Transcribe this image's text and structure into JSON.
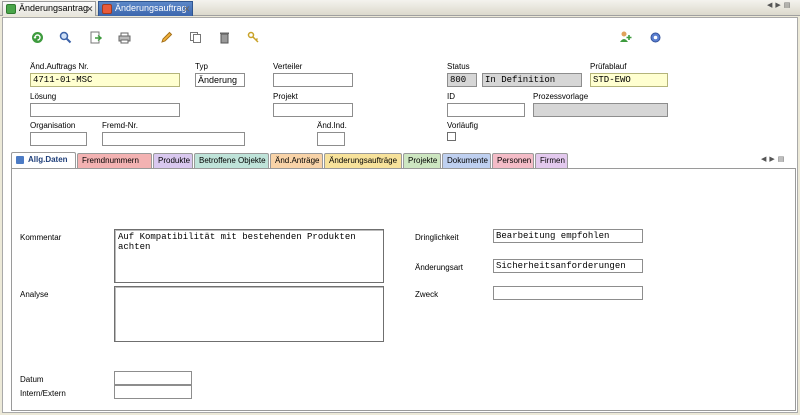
{
  "tabs": {
    "items": [
      {
        "label": "Änderungsantrag"
      },
      {
        "label": "Änderungsauftrag"
      }
    ]
  },
  "toolbar": {
    "icons": [
      "refresh-icon",
      "search-icon",
      "export-icon",
      "print-icon",
      "edit-icon",
      "copy-icon",
      "delete-icon",
      "key-icon",
      "user-add-icon",
      "settings-icon"
    ]
  },
  "form": {
    "auftrags_nr": {
      "label": "Änd.Auftrags Nr.",
      "value": "4711-01-MSC"
    },
    "typ": {
      "label": "Typ",
      "value": "Änderung"
    },
    "verteiler": {
      "label": "Verteiler",
      "value": ""
    },
    "status": {
      "label": "Status",
      "code": "800",
      "text": "In Definition"
    },
    "pruefablauf": {
      "label": "Prüfablauf",
      "value": "STD-EWO"
    },
    "loesung": {
      "label": "Lösung",
      "value": ""
    },
    "projekt": {
      "label": "Projekt",
      "value": ""
    },
    "id": {
      "label": "ID",
      "value": ""
    },
    "prozessvorlage": {
      "label": "Prozessvorlage",
      "value": ""
    },
    "organisation": {
      "label": "Organisation",
      "value": ""
    },
    "fremd_nr": {
      "label": "Fremd-Nr.",
      "value": ""
    },
    "aend_ind": {
      "label": "Änd.Ind.",
      "value": ""
    },
    "vorlaeufig": {
      "label": "Vorläufig",
      "checked": false
    }
  },
  "section_tabs": [
    {
      "label": "Allg.Daten",
      "color": "#ffffff"
    },
    {
      "label": "Fremdnummern",
      "color": "#f3b2b2"
    },
    {
      "label": "Produkte",
      "color": "#d9c8ef"
    },
    {
      "label": "Betroffene Objekte",
      "color": "#bfe3d9"
    },
    {
      "label": "Änd.Anträge",
      "color": "#f8d3a8"
    },
    {
      "label": "Änderungsaufträge",
      "color": "#f7e29b"
    },
    {
      "label": "Projekte",
      "color": "#cde6c1"
    },
    {
      "label": "Dokumente",
      "color": "#bfd0f0"
    },
    {
      "label": "Personen",
      "color": "#f4bcc7"
    },
    {
      "label": "Firmen",
      "color": "#e3c9ee"
    }
  ],
  "details": {
    "kommentar": {
      "label": "Kommentar",
      "value": "Auf Kompatibilität mit bestehenden Produkten achten"
    },
    "analyse": {
      "label": "Analyse",
      "value": ""
    },
    "dringlichkeit": {
      "label": "Dringlichkeit",
      "value": "Bearbeitung empfohlen"
    },
    "aenderungsart": {
      "label": "Änderungsart",
      "value": "Sicherheitsanforderungen"
    },
    "zweck": {
      "label": "Zweck",
      "value": ""
    },
    "datum": {
      "label": "Datum",
      "value": ""
    },
    "intern_extern": {
      "label": "Intern/Extern",
      "value": ""
    }
  },
  "colors": {
    "active_tab": "#3c66ad",
    "required_field": "#ffffd0",
    "readonly_field": "#d6d6d6"
  }
}
